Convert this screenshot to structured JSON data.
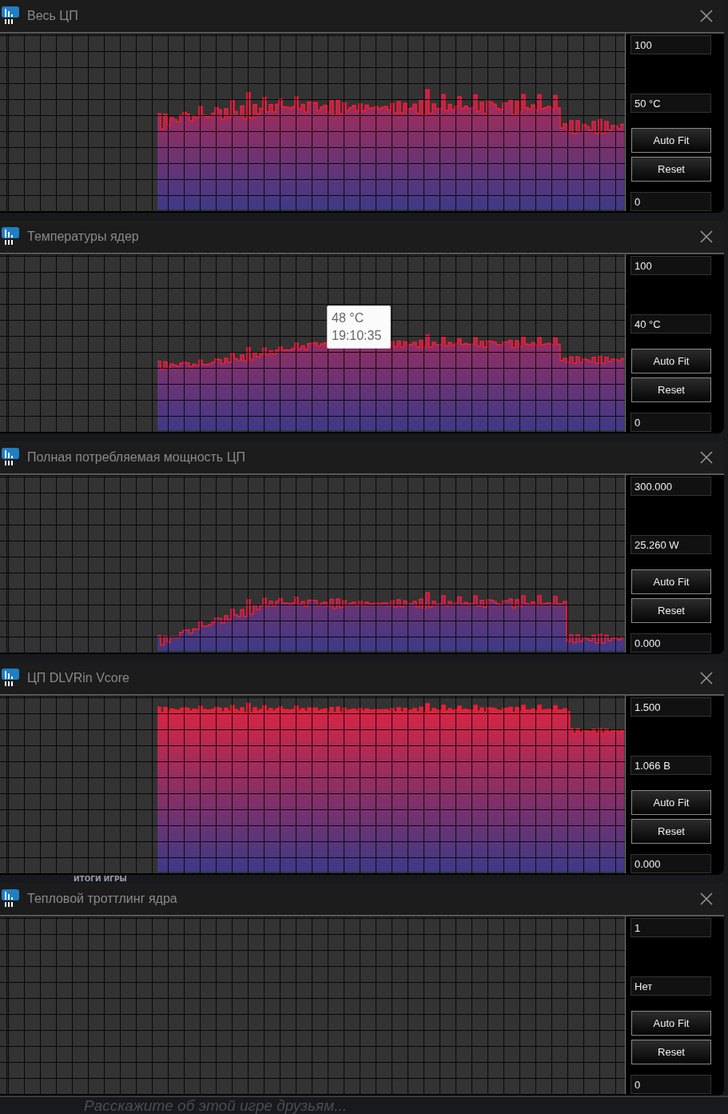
{
  "windows": [
    {
      "title": "Весь ЦП",
      "kind": "usage",
      "scale_max": "100",
      "current": "50 °C",
      "scale_min": "0",
      "buttons": [
        "Auto Fit",
        "Reset"
      ]
    },
    {
      "title": "Температуры ядер",
      "kind": "temperature",
      "scale_max": "100",
      "current": "40 °C",
      "scale_min": "0",
      "buttons": [
        "Auto Fit",
        "Reset"
      ],
      "tooltip": {
        "value": "48 °C",
        "time": "19:10:35"
      }
    },
    {
      "title": "Полная потребляемая мощность ЦП",
      "kind": "power",
      "scale_max": "300.000",
      "current": "25.260 W",
      "scale_min": "0.000",
      "buttons": [
        "Auto Fit",
        "Reset"
      ]
    },
    {
      "title": "ЦП DLVRin Vcore",
      "kind": "voltage",
      "scale_max": "1.500",
      "current": "1.066 В",
      "scale_min": "0.000",
      "buttons": [
        "Auto Fit",
        "Reset"
      ]
    },
    {
      "title": "Тепловой троттлинг ядра",
      "kind": "none",
      "scale_max": "1",
      "current": "Нет",
      "scale_min": "0",
      "buttons": [
        "Auto Fit",
        "Reset"
      ]
    }
  ],
  "background": {
    "heading": "ИТОГИ ИГРЫ",
    "prompt": "Расскажите об этой игре друзьям..."
  }
}
